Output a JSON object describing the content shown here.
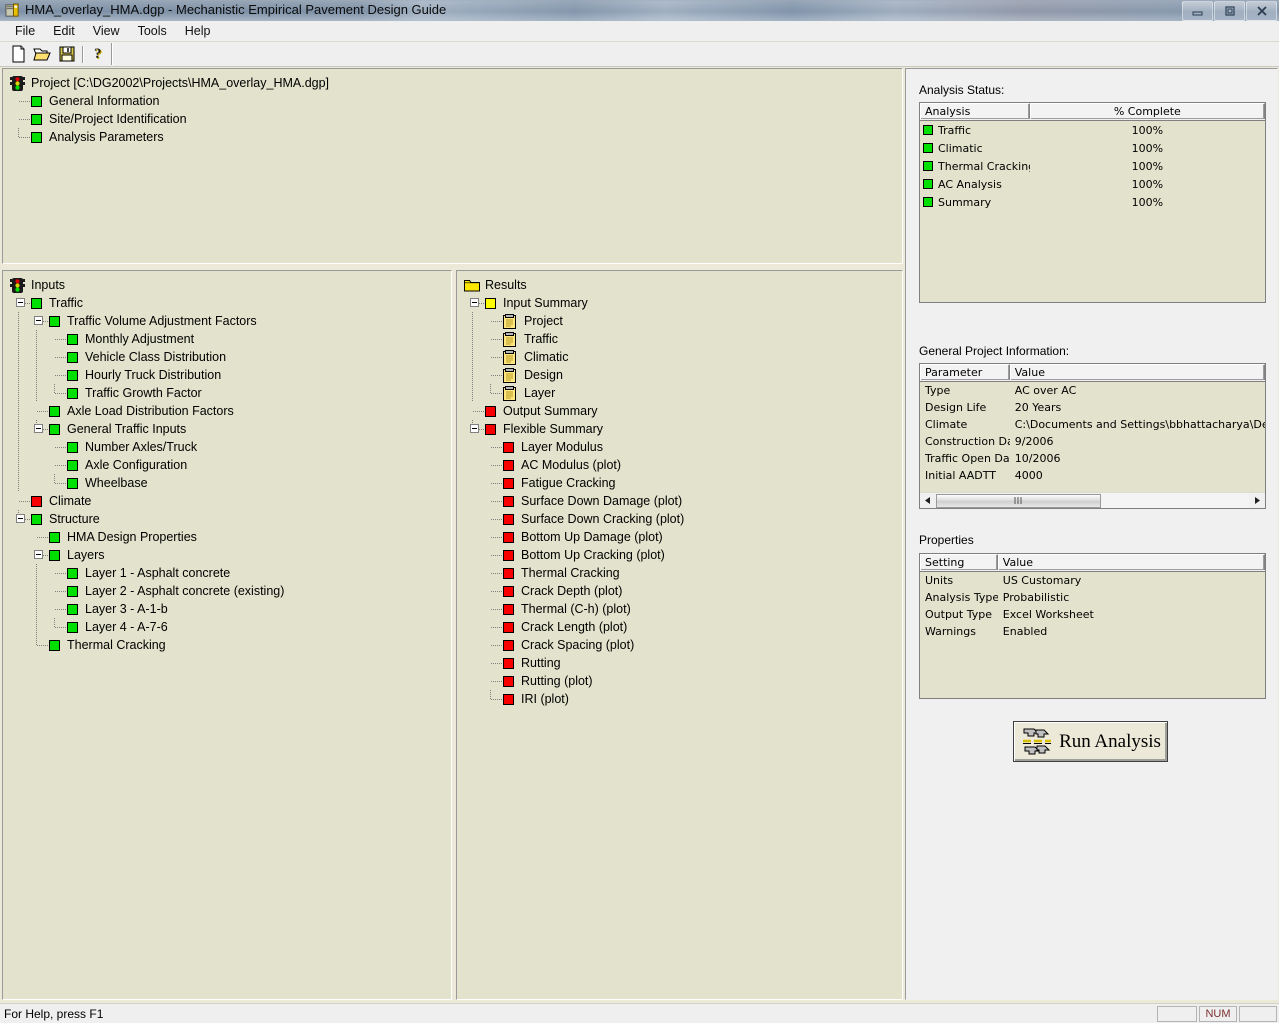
{
  "window": {
    "title": "HMA_overlay_HMA.dgp - Mechanistic Empirical Pavement Design Guide",
    "app_icon": "pavement-app-icon",
    "minimize": "minimize-icon",
    "restore": "restore-icon",
    "close": "close-icon"
  },
  "menu": [
    "File",
    "Edit",
    "View",
    "Tools",
    "Help"
  ],
  "toolbar": [
    {
      "name": "new-file-icon",
      "title": "New"
    },
    {
      "name": "open-folder-icon",
      "title": "Open"
    },
    {
      "name": "save-disk-icon",
      "title": "Save"
    },
    {
      "name": "help-question-icon",
      "title": "Help"
    }
  ],
  "project_tree": {
    "root": {
      "label": "Project [C:\\DG2002\\Projects\\HMA_overlay_HMA.dgp]",
      "icon": "traffic-light-icon"
    },
    "items": [
      {
        "label": "General Information",
        "status": "green"
      },
      {
        "label": "Site/Project Identification",
        "status": "green"
      },
      {
        "label": "Analysis Parameters",
        "status": "green"
      }
    ]
  },
  "inputs_tree": {
    "root": {
      "label": "Inputs",
      "icon": "traffic-light-icon"
    },
    "nodes": [
      {
        "label": "Traffic",
        "status": "green",
        "depth": 1,
        "expander": "minus"
      },
      {
        "label": "Traffic Volume Adjustment Factors",
        "status": "green",
        "depth": 2,
        "expander": "minus"
      },
      {
        "label": "Monthly Adjustment",
        "status": "green",
        "depth": 3
      },
      {
        "label": "Vehicle Class Distribution",
        "status": "green",
        "depth": 3
      },
      {
        "label": "Hourly Truck Distribution",
        "status": "green",
        "depth": 3
      },
      {
        "label": "Traffic Growth Factor",
        "status": "green",
        "depth": 3
      },
      {
        "label": "Axle Load Distribution Factors",
        "status": "green",
        "depth": 2
      },
      {
        "label": "General Traffic Inputs",
        "status": "green",
        "depth": 2,
        "expander": "minus"
      },
      {
        "label": "Number Axles/Truck",
        "status": "green",
        "depth": 3
      },
      {
        "label": "Axle Configuration",
        "status": "green",
        "depth": 3
      },
      {
        "label": "Wheelbase",
        "status": "green",
        "depth": 3
      },
      {
        "label": "Climate",
        "status": "red",
        "depth": 1
      },
      {
        "label": "Structure",
        "status": "green",
        "depth": 1,
        "expander": "minus"
      },
      {
        "label": "HMA Design Properties",
        "status": "green",
        "depth": 2
      },
      {
        "label": "Layers",
        "status": "green",
        "depth": 2,
        "expander": "minus"
      },
      {
        "label": "Layer 1 - Asphalt concrete",
        "status": "green",
        "depth": 3
      },
      {
        "label": "Layer 2 - Asphalt concrete (existing)",
        "status": "green",
        "depth": 3
      },
      {
        "label": "Layer 3 - A-1-b",
        "status": "green",
        "depth": 3
      },
      {
        "label": "Layer 4 - A-7-6",
        "status": "green",
        "depth": 3
      },
      {
        "label": "Thermal Cracking",
        "status": "green",
        "depth": 2
      }
    ]
  },
  "results_tree": {
    "root": {
      "label": "Results",
      "icon": "folder-icon"
    },
    "nodes": [
      {
        "label": "Input Summary",
        "status": "yellow",
        "depth": 1,
        "expander": "minus"
      },
      {
        "label": "Project",
        "status": "doc",
        "depth": 2
      },
      {
        "label": "Traffic",
        "status": "doc",
        "depth": 2
      },
      {
        "label": "Climatic",
        "status": "doc",
        "depth": 2
      },
      {
        "label": "Design",
        "status": "doc",
        "depth": 2
      },
      {
        "label": "Layer",
        "status": "doc",
        "depth": 2
      },
      {
        "label": "Output Summary",
        "status": "red",
        "depth": 1
      },
      {
        "label": "Flexible Summary",
        "status": "red",
        "depth": 1,
        "expander": "minus"
      },
      {
        "label": "Layer Modulus",
        "status": "red",
        "depth": 2
      },
      {
        "label": "AC Modulus (plot)",
        "status": "red",
        "depth": 2
      },
      {
        "label": "Fatigue Cracking",
        "status": "red",
        "depth": 2
      },
      {
        "label": "Surface Down Damage (plot)",
        "status": "red",
        "depth": 2
      },
      {
        "label": "Surface Down Cracking (plot)",
        "status": "red",
        "depth": 2
      },
      {
        "label": "Bottom Up Damage (plot)",
        "status": "red",
        "depth": 2
      },
      {
        "label": "Bottom Up Cracking (plot)",
        "status": "red",
        "depth": 2
      },
      {
        "label": "Thermal Cracking",
        "status": "red",
        "depth": 2
      },
      {
        "label": "Crack Depth (plot)",
        "status": "red",
        "depth": 2
      },
      {
        "label": "Thermal (C-h) (plot)",
        "status": "red",
        "depth": 2
      },
      {
        "label": "Crack Length (plot)",
        "status": "red",
        "depth": 2
      },
      {
        "label": "Crack Spacing (plot)",
        "status": "red",
        "depth": 2
      },
      {
        "label": "Rutting",
        "status": "red",
        "depth": 2
      },
      {
        "label": "Rutting (plot)",
        "status": "red",
        "depth": 2
      },
      {
        "label": "IRI (plot)",
        "status": "red",
        "depth": 2
      }
    ]
  },
  "analysis_status": {
    "label": "Analysis Status:",
    "columns": [
      "Analysis",
      "% Complete"
    ],
    "rows": [
      {
        "name": "Traffic",
        "percent": "100%",
        "status": "green"
      },
      {
        "name": "Climatic",
        "percent": "100%",
        "status": "green"
      },
      {
        "name": "Thermal Cracking",
        "percent": "100%",
        "status": "green"
      },
      {
        "name": "AC Analysis",
        "percent": "100%",
        "status": "green"
      },
      {
        "name": "Summary",
        "percent": "100%",
        "status": "green"
      }
    ]
  },
  "general_info": {
    "label": "General Project Information:",
    "columns": [
      "Parameter",
      "Value"
    ],
    "rows": [
      {
        "parameter": "Type",
        "value": "AC over AC"
      },
      {
        "parameter": "Design Life",
        "value": "20 Years"
      },
      {
        "parameter": "Climate",
        "value": "C:\\Documents and Settings\\bbhattacharya\\Deskto"
      },
      {
        "parameter": "Construction Date",
        "value": "9/2006"
      },
      {
        "parameter": "Traffic Open Date",
        "value": "10/2006"
      },
      {
        "parameter": "Initial AADTT",
        "value": "4000"
      }
    ]
  },
  "properties": {
    "label": "Properties",
    "columns": [
      "Setting",
      "Value"
    ],
    "rows": [
      {
        "setting": "Units",
        "value": "US Customary"
      },
      {
        "setting": "Analysis Type",
        "value": "Probabilistic"
      },
      {
        "setting": "Output Type",
        "value": "Excel Worksheet"
      },
      {
        "setting": "Warnings",
        "value": "Enabled"
      }
    ]
  },
  "run_button": {
    "label": "Run Analysis",
    "icon": "run-analysis-icon"
  },
  "statusbar": {
    "help_text": "For Help, press F1",
    "num_indicator": "NUM"
  },
  "colors": {
    "panel_beige": "#e3e3cd",
    "status_green": "#00e000",
    "status_red": "#f80000",
    "status_yellow": "#ffff00",
    "right_panel": "#f0f0f0"
  }
}
